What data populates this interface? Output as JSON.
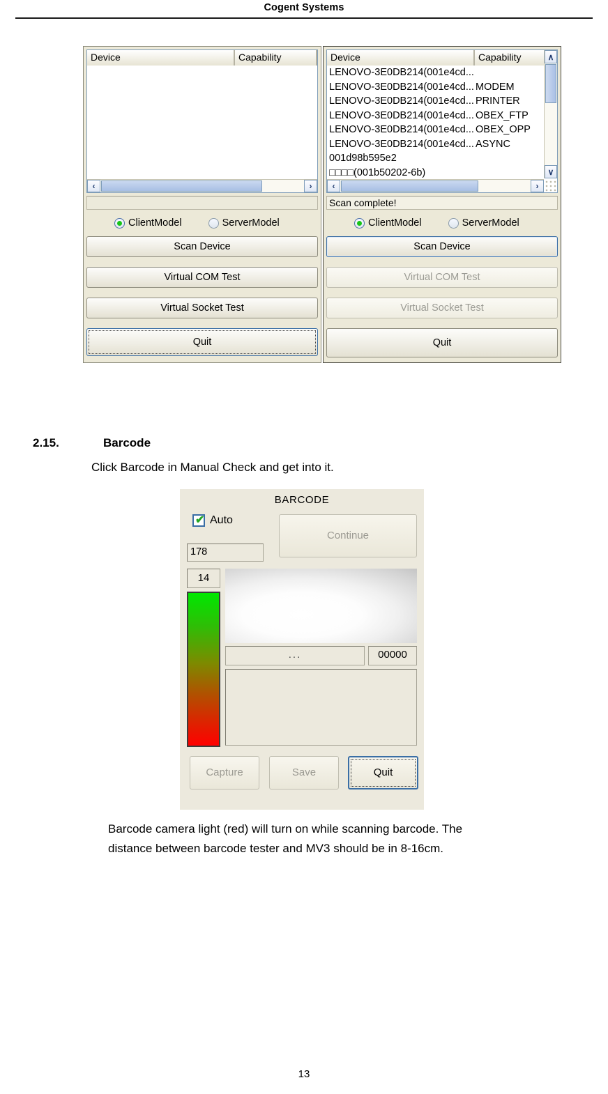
{
  "document": {
    "header": "Cogent Systems",
    "page_number": "13"
  },
  "section": {
    "number": "2.15.",
    "title": "Barcode",
    "intro": "Click Barcode in Manual Check and get into it.",
    "note_line1": "Barcode camera light (red) will turn on while scanning barcode. The",
    "note_line2": "distance between barcode tester and MV3 should be in 8-16cm."
  },
  "bluetooth_tester": {
    "columns": [
      "Device",
      "Capability"
    ],
    "left_panel": {
      "rows": [],
      "status": "",
      "radios": [
        {
          "label": "ClientModel",
          "selected": true
        },
        {
          "label": "ServerModel",
          "selected": false
        }
      ],
      "buttons": [
        {
          "label": "Scan Device",
          "state": "enabled"
        },
        {
          "label": "Virtual COM Test",
          "state": "enabled"
        },
        {
          "label": "Virtual Socket Test",
          "state": "enabled"
        },
        {
          "label": "Quit",
          "state": "focused"
        }
      ],
      "hscroll": {
        "left_arrow": "‹",
        "right_arrow": "›"
      }
    },
    "right_panel": {
      "rows": [
        {
          "device": "LENOVO-3E0DB214(001e4cd...",
          "capability": ""
        },
        {
          "device": "LENOVO-3E0DB214(001e4cd...",
          "capability": "MODEM"
        },
        {
          "device": "LENOVO-3E0DB214(001e4cd...",
          "capability": "PRINTER"
        },
        {
          "device": "LENOVO-3E0DB214(001e4cd...",
          "capability": "OBEX_FTP"
        },
        {
          "device": "LENOVO-3E0DB214(001e4cd...",
          "capability": "OBEX_OPP"
        },
        {
          "device": "LENOVO-3E0DB214(001e4cd...",
          "capability": "ASYNC"
        },
        {
          "device": "001d98b595e2",
          "capability": ""
        },
        {
          "device": "□□□□(001b50202-6b)",
          "capability": ""
        }
      ],
      "status": "Scan complete!",
      "radios": [
        {
          "label": "ClientModel",
          "selected": true
        },
        {
          "label": "ServerModel",
          "selected": false
        }
      ],
      "buttons": [
        {
          "label": "Scan Device",
          "state": "highlighted"
        },
        {
          "label": "Virtual COM Test",
          "state": "disabled"
        },
        {
          "label": "Virtual Socket Test",
          "state": "disabled"
        },
        {
          "label": "Quit",
          "state": "enabled"
        }
      ],
      "scroll": {
        "up_arrow": "∧",
        "down_arrow": "∨",
        "left_arrow": "‹",
        "right_arrow": "›"
      }
    }
  },
  "barcode_dialog": {
    "title": "BARCODE",
    "auto_checkbox": {
      "label": "Auto",
      "checked": true,
      "tick": "✔"
    },
    "continue_button": {
      "label": "Continue",
      "state": "disabled"
    },
    "exposure_value": "178",
    "gain_value": "14",
    "signal_field": "...",
    "counter_field": "00000",
    "result_field": "",
    "buttons": [
      {
        "label": "Capture",
        "state": "disabled"
      },
      {
        "label": "Save",
        "state": "disabled"
      },
      {
        "label": "Quit",
        "state": "focused"
      }
    ],
    "colors": {
      "bar_top": "#00e800",
      "bar_bottom": "#ff0000",
      "check": "#22a522",
      "focus_border": "#3a6ea5"
    }
  }
}
